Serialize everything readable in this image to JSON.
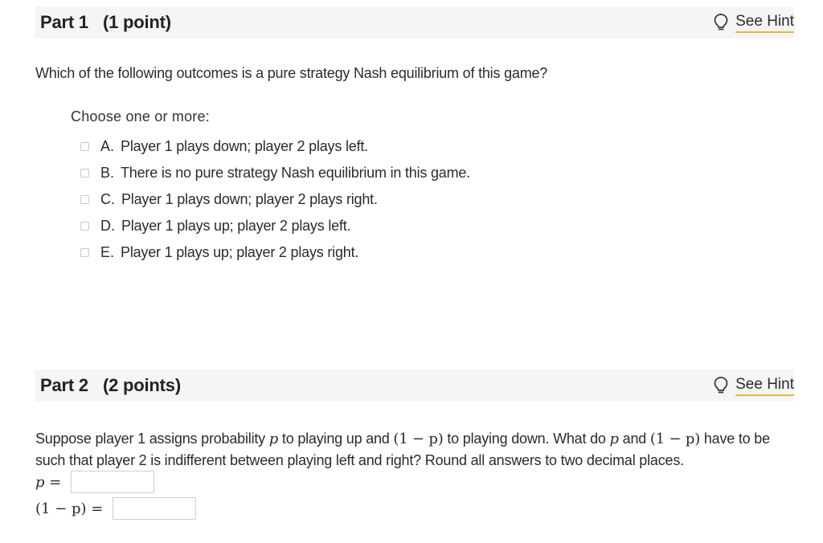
{
  "part1": {
    "title": "Part 1",
    "points": "(1 point)",
    "hint_label": "See Hint",
    "question": "Which of the following outcomes is a pure strategy Nash equilibrium of this game?",
    "choose_label": "Choose one or more:",
    "options": [
      {
        "letter": "A.",
        "text": "Player 1 plays down; player 2 plays left.",
        "checked": false
      },
      {
        "letter": "B.",
        "text": "There is no pure strategy Nash equilibrium in this game.",
        "checked": false
      },
      {
        "letter": "C.",
        "text": "Player 1 plays down; player 2 plays right.",
        "checked": false
      },
      {
        "letter": "D.",
        "text": "Player 1 plays up; player 2 plays left.",
        "checked": false
      },
      {
        "letter": "E.",
        "text": "Player 1 plays up; player 2 plays right.",
        "checked": false
      }
    ]
  },
  "part2": {
    "title": "Part 2",
    "points": "(2 points)",
    "hint_label": "See Hint",
    "text_1": "Suppose player 1 assigns probability ",
    "var_p": "p",
    "text_2": " to playing up and ",
    "expr_1mp": "(1 − p)",
    "text_3": " to playing down. What do ",
    "text_4": " and ",
    "text_5": " have to be such that player 2 is indifferent between playing left and right? Round all answers to two decimal places.",
    "answers": [
      {
        "label": "p =",
        "value": ""
      },
      {
        "label": "(1 − p) =",
        "value": ""
      }
    ]
  },
  "icons": {
    "hint": "lightbulb-icon",
    "checkbox": "checkbox-icon"
  },
  "colors": {
    "header_bg": "#f5f5f5",
    "hint_underline": "#e2b93b",
    "text": "#2b2b2b"
  }
}
